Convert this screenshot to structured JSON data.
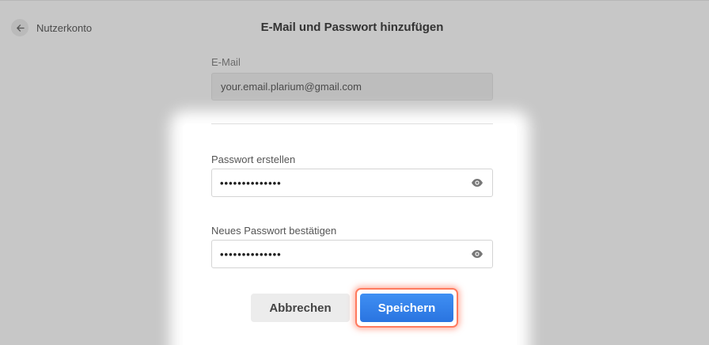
{
  "header": {
    "back_label": "Nutzerkonto",
    "title": "E-Mail und Passwort hinzufügen"
  },
  "email": {
    "label": "E-Mail",
    "value": "your.email.plarium@gmail.com"
  },
  "password": {
    "label": "Passwort erstellen",
    "value": "••••••••••••••"
  },
  "confirm_password": {
    "label": "Neues Passwort bestätigen",
    "value": "••••••••••••••"
  },
  "buttons": {
    "cancel_label": "Abbrechen",
    "save_label": "Speichern"
  },
  "icons": {
    "back": "arrow-left-icon",
    "reveal": "eye-icon"
  },
  "colors": {
    "primary": "#2f7be6",
    "highlight": "#ff7a5e",
    "overlay": "#c7c7c7"
  }
}
